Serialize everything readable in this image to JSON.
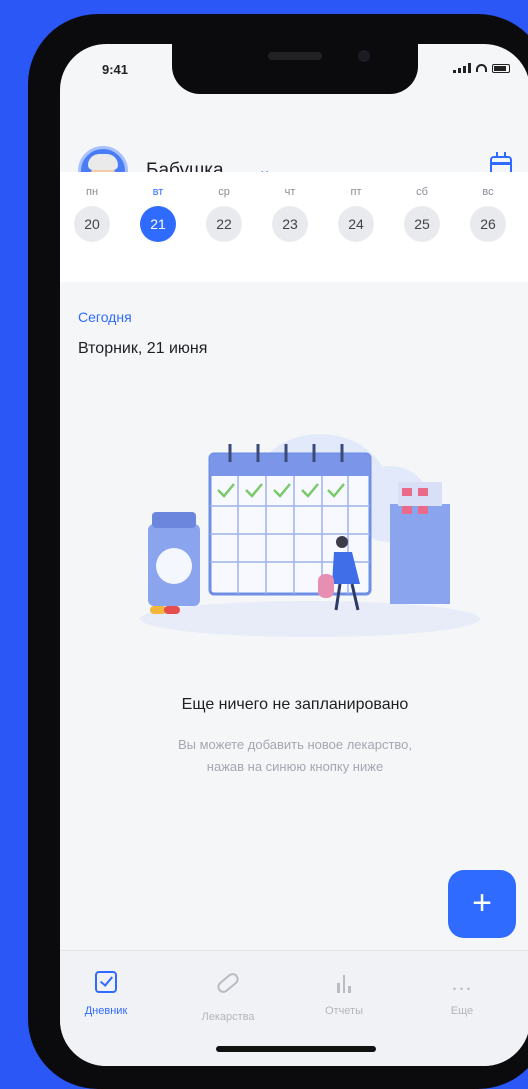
{
  "status": {
    "time": "9:41"
  },
  "header": {
    "profile_name": "Бабушка",
    "avatar_icon": "grandmother-avatar",
    "calendar_icon": "calendar-icon"
  },
  "week": {
    "days": [
      {
        "name": "пн",
        "num": "20",
        "active": false
      },
      {
        "name": "вт",
        "num": "21",
        "active": true
      },
      {
        "name": "ср",
        "num": "22",
        "active": false
      },
      {
        "name": "чт",
        "num": "23",
        "active": false
      },
      {
        "name": "пт",
        "num": "24",
        "active": false
      },
      {
        "name": "сб",
        "num": "25",
        "active": false
      },
      {
        "name": "вс",
        "num": "26",
        "active": false
      }
    ]
  },
  "main": {
    "today_label": "Сегодня",
    "date": "Вторник, 21 июня",
    "empty_title": "Еще ничего не запланировано",
    "empty_text_1": "Вы можете добавить новое лекарство,",
    "empty_text_2": "нажав на синюю кнопку ниже"
  },
  "fab": {
    "label": "+"
  },
  "tabs": [
    {
      "label": "Дневник",
      "icon": "diary-icon",
      "active": true
    },
    {
      "label": "Лекарства",
      "icon": "pill-icon",
      "active": false
    },
    {
      "label": "Отчеты",
      "icon": "bar-chart-icon",
      "active": false
    },
    {
      "label": "Еще",
      "icon": "more-icon",
      "active": false
    }
  ],
  "colors": {
    "accent": "#2f6bff",
    "background": "#2a57f5"
  }
}
